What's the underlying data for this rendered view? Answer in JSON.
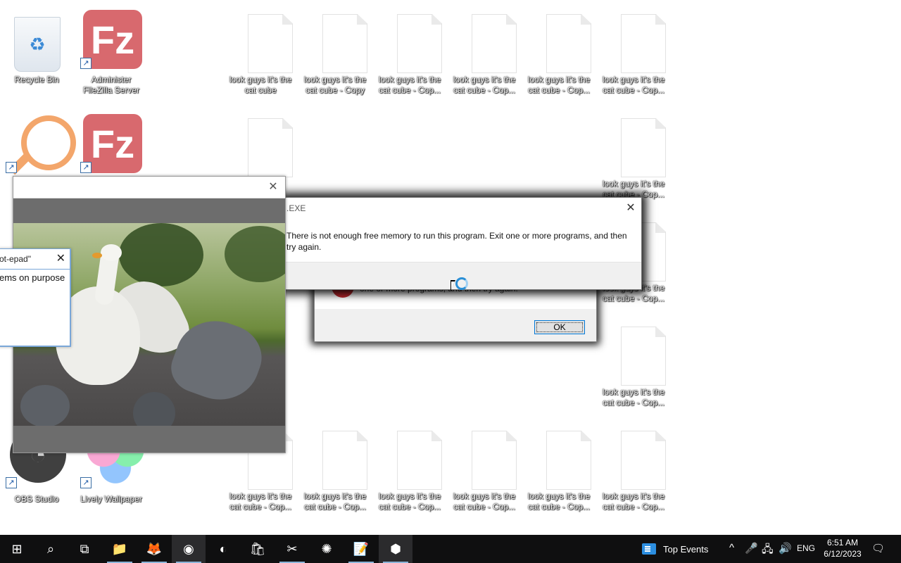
{
  "desktop": {
    "icons": [
      {
        "label": "Recycle Bin",
        "icon": "recycle-bin-icon"
      },
      {
        "label": "Administer FileZilla Server",
        "icon": "filezilla-icon"
      },
      {
        "label": "",
        "icon": "magnifier-icon"
      },
      {
        "label": "",
        "icon": "filezilla-icon"
      },
      {
        "label": "OBS Studio",
        "icon": "obs-icon"
      },
      {
        "label": "Lively Wallpaper",
        "icon": "lively-wallpaper-icon"
      },
      {
        "label": "look guys it's the cat cube",
        "icon": "text-file-icon"
      },
      {
        "label": "look guys it's the cat cube - Copy",
        "icon": "text-file-icon"
      },
      {
        "label": "look guys it's the cat cube - Cop...",
        "icon": "text-file-icon"
      },
      {
        "label": "look guys it's the cat cube - Cop...",
        "icon": "text-file-icon"
      },
      {
        "label": "look guys it's the cat cube - Cop...",
        "icon": "text-file-icon"
      },
      {
        "label": "look guys it's the cat cube - Cop...",
        "icon": "text-file-icon"
      },
      {
        "label": "look guys it's the cat cube - Cop...",
        "icon": "text-file-icon"
      },
      {
        "label": "look guys it's the cat cube - Cop...",
        "icon": "text-file-icon"
      },
      {
        "label": "look guys it's the cat cube - Cop...",
        "icon": "text-file-icon"
      },
      {
        "label": "look guys it's the cat cube - Cop...",
        "icon": "text-file-icon"
      },
      {
        "label": "look guys it's the cat cube - Cop...",
        "icon": "text-file-icon"
      },
      {
        "label": "look guys it's the cat cube - Cop...",
        "icon": "text-file-icon"
      },
      {
        "label": "look guys it's the cat cube - Cop...",
        "icon": "text-file-icon"
      },
      {
        "label": "look guys it's the cat cube - Cop...",
        "icon": "text-file-icon"
      }
    ]
  },
  "error_front": {
    "title": ".EXE",
    "message": "There is not enough free memory to run this program. Exit one or more programs, and then try again.",
    "close_glyph": "✕"
  },
  "error_back": {
    "message_fragment": "one or more programs, and then try again.",
    "ok_label": "OK"
  },
  "goose_window": {
    "close_glyph": "✕"
  },
  "notepad_window": {
    "title": "ot-epad\"",
    "text": "ems on purpose",
    "close_glyph": "✕"
  },
  "taskbar": {
    "apps": [
      {
        "name": "start-button",
        "glyph": "⊞"
      },
      {
        "name": "search-icon",
        "glyph": "⌕"
      },
      {
        "name": "task-view-icon",
        "glyph": "⧉"
      },
      {
        "name": "file-explorer-icon",
        "glyph": "📁"
      },
      {
        "name": "firefox-icon",
        "glyph": "🦊"
      },
      {
        "name": "chrome-icon",
        "glyph": "◉"
      },
      {
        "name": "edge-icon",
        "glyph": "◐"
      },
      {
        "name": "store-icon",
        "glyph": "🛍"
      },
      {
        "name": "snipping-tool-icon",
        "glyph": "✂"
      },
      {
        "name": "color-wheel-icon",
        "glyph": "✺"
      },
      {
        "name": "notepad-icon",
        "glyph": "📝"
      },
      {
        "name": "cube-app-icon",
        "glyph": "⬢"
      }
    ],
    "top_events_label": "Top Events",
    "tray": {
      "chevron_glyph": "^",
      "mic_glyph": "🎤",
      "network_glyph": "🖧",
      "volume_glyph": "🔊",
      "language": "ENG",
      "notification_glyph": "🗨"
    },
    "time": "6:51 AM",
    "date": "6/12/2023"
  }
}
